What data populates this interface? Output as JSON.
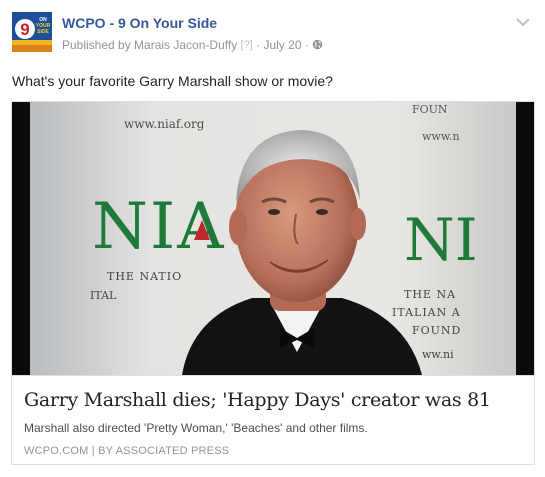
{
  "post": {
    "page_name": "WCPO - 9 On Your Side",
    "published_by": "Published by Marais Jacon-Duffy",
    "help_marker": "[?]",
    "separator": "·",
    "date": "July 20",
    "separator2": "·",
    "audience_icon": "globe-icon",
    "menu_icon": "chevron-down-icon",
    "text": "What's your favorite Garry Marshall show or movie?"
  },
  "avatar": {
    "logo_number": "9",
    "logo_text_lines": [
      "ON",
      "YOUR",
      "SIDE"
    ]
  },
  "link_card": {
    "backdrop_texts": {
      "url_left": "www.niaf.org",
      "url_right": "www.n",
      "found_top": "FOUN",
      "big_letters_left": "NIA",
      "big_letters_right": "NI",
      "nation": "THE NATIO",
      "ita": "ITAL",
      "na_right": "THE NA",
      "italian_right": "ITALIAN A",
      "found_right": "FOUND",
      "www_bottom": "ww.ni"
    },
    "headline": "Garry Marshall dies; 'Happy Days' creator was 81",
    "description": "Marshall also directed 'Pretty Woman,' 'Beaches' and other films.",
    "source": "WCPO.COM | BY ASSOCIATED PRESS"
  },
  "colors": {
    "brand_blue": "#365899",
    "meta_gray": "#90949c",
    "border": "#dddfe2",
    "niaf_green": "#1f7a3a",
    "niaf_red": "#c0272d"
  }
}
